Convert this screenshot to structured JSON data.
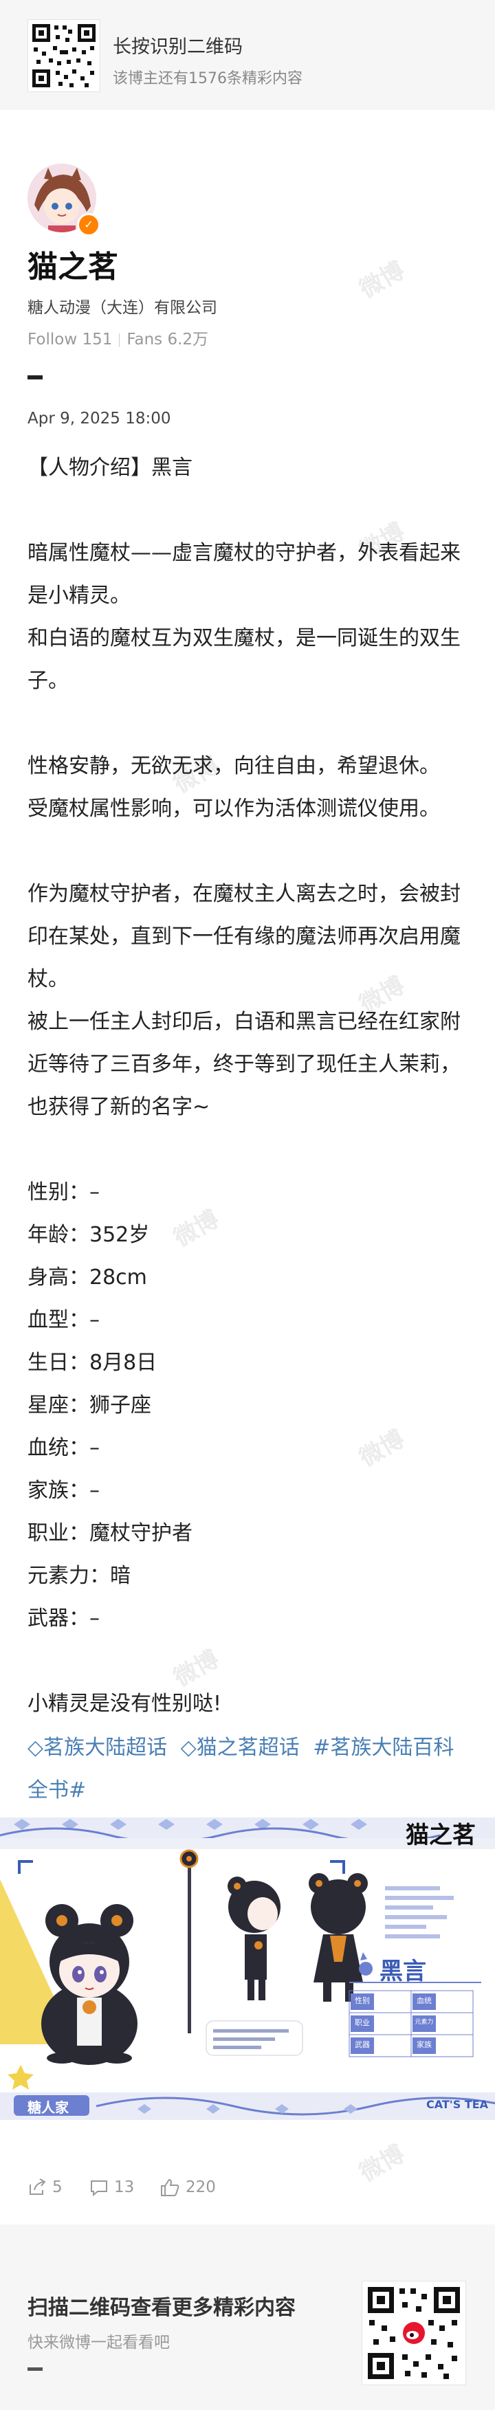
{
  "top_banner": {
    "title": "长按识别二维码",
    "subtitle": "该博主还有1576条精彩内容"
  },
  "profile": {
    "name": "猫之茗",
    "organization": "糖人动漫（大连）有限公司",
    "follow_label": "Follow 151",
    "fans_label": "Fans 6.2万",
    "verified": true
  },
  "post": {
    "date": "Apr 9, 2025 18:00",
    "text": "【人物介绍】黑言\n\n暗属性魔杖——虚言魔杖的守护者，外表看起来是小精灵。\n和白语的魔杖互为双生魔杖，是一同诞生的双生子。\n\n性格安静，无欲无求，向往自由，希望退休。\n受魔杖属性影响，可以作为活体测谎仪使用。\n\n作为魔杖守护者，在魔杖主人离去之时，会被封印在某处，直到下一任有缘的魔法师再次启用魔杖。\n被上一任主人封印后，白语和黑言已经在红家附近等待了三百多年，终于等到了现任主人茉莉，也获得了新的名字~\n\n性别：–\n年龄：352岁\n身高：28cm\n血型：–\n生日：8月8日\n星座：狮子座\n血统：–\n家族：–\n职业：魔杖守护者\n元素力：暗\n武器：–\n\n小精灵是没有性别哒!",
    "tags": [
      "◇茗族大陆超话",
      "◇猫之茗超话",
      "#茗族大陆百科全书#"
    ]
  },
  "artwork": {
    "logo_text": "猫之茗",
    "character_name": "黑言",
    "studio_label": "糖人家",
    "brand_label": "CAT'S TEA",
    "field_labels": [
      "性别",
      "血统",
      "职业",
      "元素力",
      "武器",
      "家族"
    ],
    "accent_colors": [
      "#a8b8e8",
      "#f2d24a",
      "#6c7fd0",
      "#222222"
    ]
  },
  "actions": {
    "share_count": "5",
    "comment_count": "13",
    "like_count": "220"
  },
  "bottom_banner": {
    "title": "扫描二维码查看更多精彩内容",
    "subtitle": "快来微博一起看看吧"
  }
}
